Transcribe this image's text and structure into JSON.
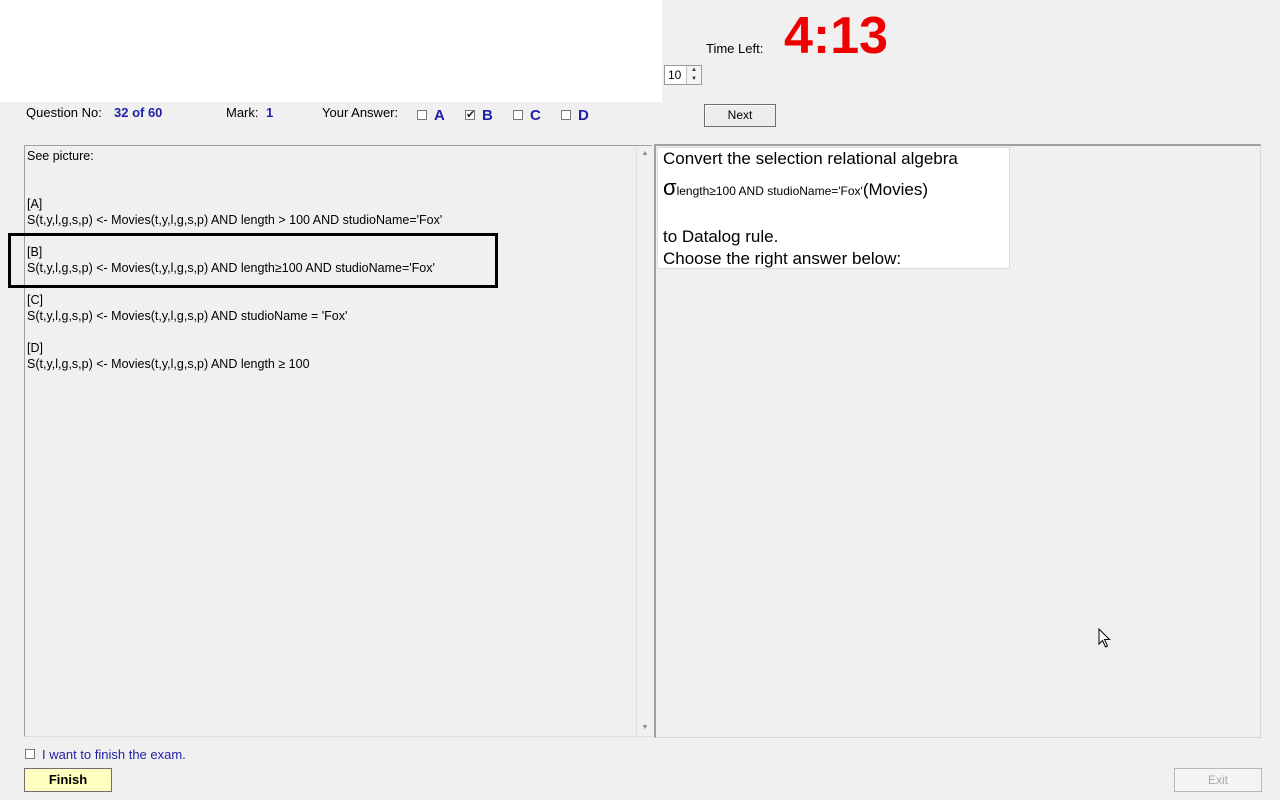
{
  "timer": {
    "label": "Time Left:",
    "value": "4:13"
  },
  "font_size_spinner": {
    "value": "10"
  },
  "question_info": {
    "question_no_label": "Question No:",
    "question_no_value": "32 of 60",
    "mark_label": "Mark:",
    "mark_value": "1",
    "answer_label": "Your Answer:",
    "options": [
      {
        "letter": "A",
        "checked": false
      },
      {
        "letter": "B",
        "checked": true
      },
      {
        "letter": "C",
        "checked": false
      },
      {
        "letter": "D",
        "checked": false
      }
    ]
  },
  "buttons": {
    "next": "Next",
    "finish": "Finish",
    "exit": "Exit"
  },
  "question": {
    "intro": "See picture:",
    "choices": [
      {
        "tag": "[A]",
        "text": "S(t,y,l,g,s,p) <- Movies(t,y,l,g,s,p) AND length > 100 AND studioName='Fox'"
      },
      {
        "tag": "[B]",
        "text": "S(t,y,l,g,s,p) <- Movies(t,y,l,g,s,p) AND length≥100 AND studioName='Fox'"
      },
      {
        "tag": "[C]",
        "text": "S(t,y,l,g,s,p) <- Movies(t,y,l,g,s,p) AND studioName = 'Fox'"
      },
      {
        "tag": "[D]",
        "text": "S(t,y,l,g,s,p) <- Movies(t,y,l,g,s,p) AND length ≥ 100"
      }
    ]
  },
  "picture": {
    "line1": "Convert the selection relational algebra",
    "sigma": "σ",
    "subscript": "length≥100 AND studioName='Fox'",
    "relation": "(Movies)",
    "line3": "to Datalog rule.",
    "line4": "Choose the right answer below:"
  },
  "finish_confirm": {
    "label": "I want to finish the exam.",
    "checked": false
  }
}
